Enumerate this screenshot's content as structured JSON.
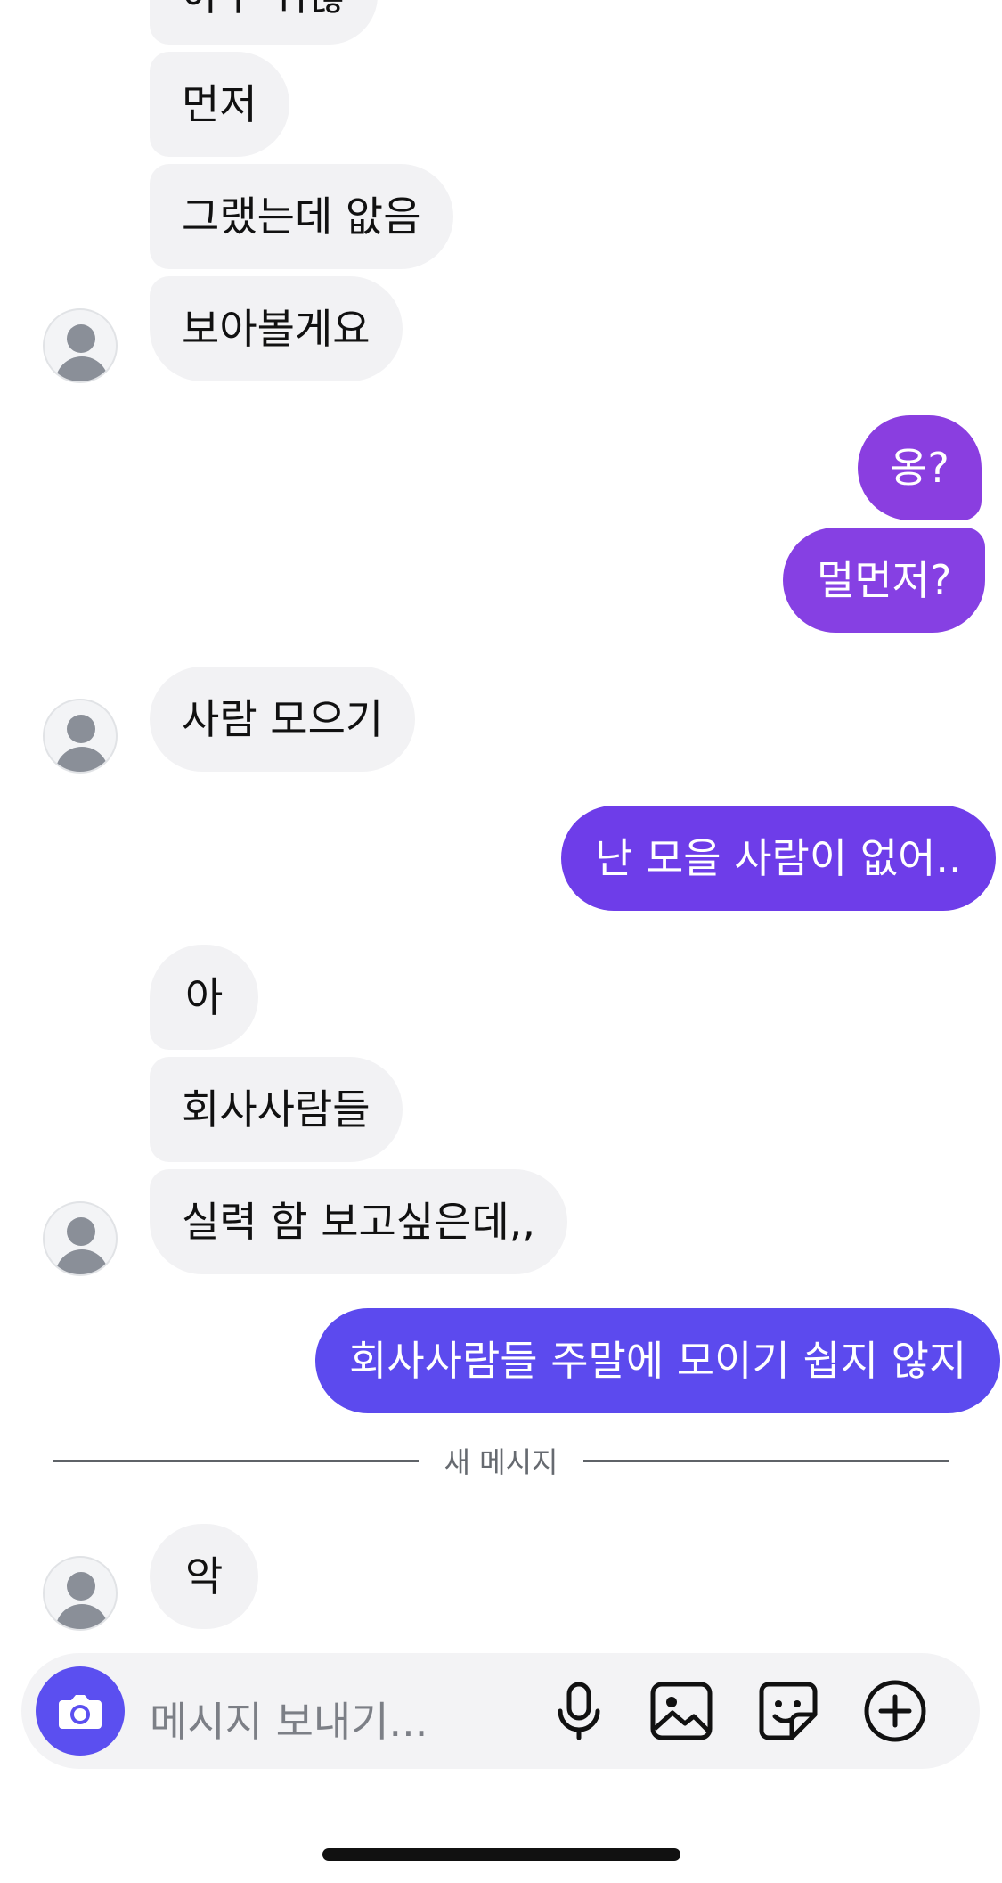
{
  "messages": [
    {
      "id": "m0",
      "text": "아우 귀찮"
    },
    {
      "id": "m1",
      "text": "먼저"
    },
    {
      "id": "m2",
      "text": "그랬는데 앖음"
    },
    {
      "id": "m3",
      "text": "보아볼게요"
    },
    {
      "id": "m4",
      "text": "옹?"
    },
    {
      "id": "m5",
      "text": "멀먼저?"
    },
    {
      "id": "m6",
      "text": "사람 모으기"
    },
    {
      "id": "m7",
      "text": "난 모을 사람이 없어.."
    },
    {
      "id": "m8",
      "text": "아"
    },
    {
      "id": "m9",
      "text": "회사사람들"
    },
    {
      "id": "m10",
      "text": "실력 함 보고싶은데,,"
    },
    {
      "id": "m11",
      "text": "회사사람들 주말에 모이기 쉽지 않지"
    },
    {
      "id": "m12",
      "text": "악"
    }
  ],
  "divider": {
    "label": "새 메시지"
  },
  "composer": {
    "placeholder": "메시지 보내기..."
  },
  "colors": {
    "incoming_bubble": "#f2f2f4",
    "outgoing_gradient_top": "#8a3ee0",
    "outgoing_gradient_bottom": "#5b4ff0",
    "camera_button": "#5b4ff0"
  },
  "icons": [
    "camera-icon",
    "microphone-icon",
    "image-icon",
    "sticker-icon",
    "add-circle-icon"
  ]
}
